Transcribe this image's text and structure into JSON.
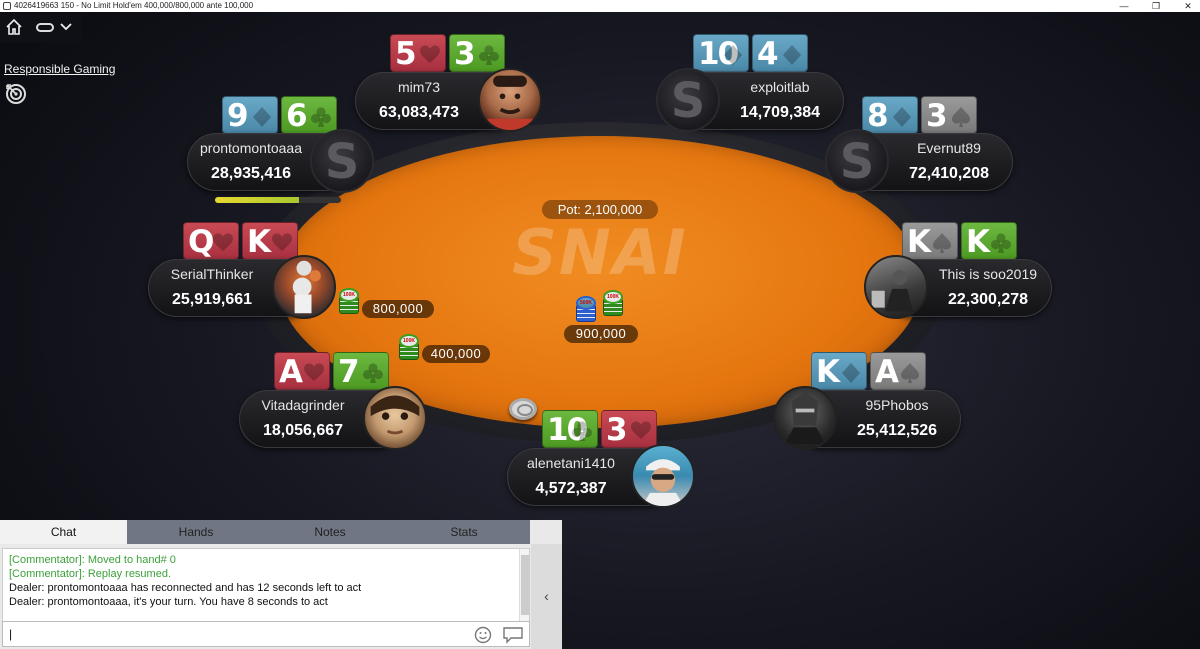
{
  "window": {
    "title": "4026419663 150 - No Limit Hold'em 400,000/800,000 ante 100,000",
    "controls": [
      "—",
      "❐",
      "✕"
    ]
  },
  "top_controls": {
    "responsible_gaming": "Responsible Gaming"
  },
  "table": {
    "logo": "SNAI",
    "pot_label": "Pot: 2,100,000",
    "center_bet": "900,000",
    "felt_color": "#e67710"
  },
  "players": [
    {
      "id": "mim73",
      "name": "mim73",
      "stack": "63,083,473",
      "cards": [
        {
          "rank": "5",
          "suit": "heart",
          "color": "red"
        },
        {
          "rank": "3",
          "suit": "club",
          "color": "green"
        }
      ],
      "avatar": "man-avatar"
    },
    {
      "id": "exploitlab",
      "name": "exploitlab",
      "stack": "14,709,384",
      "cards": [
        {
          "rank": "10",
          "suit": "diamond",
          "color": "blue"
        },
        {
          "rank": "4",
          "suit": "diamond",
          "color": "blue"
        }
      ],
      "avatar": "snai-s-avatar"
    },
    {
      "id": "prontomontoaaa",
      "name": "prontomontoaaa",
      "stack": "28,935,416",
      "cards": [
        {
          "rank": "9",
          "suit": "diamond",
          "color": "blue"
        },
        {
          "rank": "6",
          "suit": "club",
          "color": "green"
        }
      ],
      "avatar": "snai-s-avatar",
      "timer_fraction": 0.67
    },
    {
      "id": "evernut89",
      "name": "Evernut89",
      "stack": "72,410,208",
      "cards": [
        {
          "rank": "8",
          "suit": "diamond",
          "color": "blue"
        },
        {
          "rank": "3",
          "suit": "spade",
          "color": "gray"
        }
      ],
      "avatar": "snai-s-avatar"
    },
    {
      "id": "serialthinker",
      "name": "SerialThinker",
      "stack": "25,919,661",
      "cards": [
        {
          "rank": "Q",
          "suit": "heart",
          "color": "red"
        },
        {
          "rank": "K",
          "suit": "heart",
          "color": "red"
        }
      ],
      "avatar": "basketball-avatar",
      "bet": "800,000"
    },
    {
      "id": "soo2019",
      "name": "This is soo2019",
      "stack": "22,300,278",
      "cards": [
        {
          "rank": "K",
          "suit": "spade",
          "color": "gray"
        },
        {
          "rank": "K",
          "suit": "club",
          "color": "green"
        }
      ],
      "avatar": "photo-avatar"
    },
    {
      "id": "vitadagrinder",
      "name": "Vitadagrinder",
      "stack": "18,056,667",
      "cards": [
        {
          "rank": "A",
          "suit": "heart",
          "color": "red"
        },
        {
          "rank": "7",
          "suit": "club",
          "color": "green"
        }
      ],
      "avatar": "face-avatar",
      "bet": "400,000"
    },
    {
      "id": "95phobos",
      "name": "95Phobos",
      "stack": "25,412,526",
      "cards": [
        {
          "rank": "K",
          "suit": "diamond",
          "color": "blue"
        },
        {
          "rank": "A",
          "suit": "spade",
          "color": "gray"
        }
      ],
      "avatar": "warrior-avatar"
    },
    {
      "id": "alenetani1410",
      "name": "alenetani1410",
      "stack": "4,572,387",
      "cards": [
        {
          "rank": "10",
          "suit": "club",
          "color": "green"
        },
        {
          "rank": "3",
          "suit": "heart",
          "color": "red"
        }
      ],
      "avatar": "cap-man-avatar"
    }
  ],
  "chips": {
    "serialthinker": "100K",
    "vitadagrinder": "100K",
    "center_a": "500K",
    "center_b": "100K"
  },
  "chat": {
    "tabs": [
      "Chat",
      "Hands",
      "Notes",
      "Stats"
    ],
    "active_tab": "Chat",
    "lines": [
      {
        "type": "comment",
        "text": "[Commentator]: Moved to hand# 0"
      },
      {
        "type": "comment",
        "text": "[Commentator]: Replay resumed."
      },
      {
        "type": "dealer",
        "text": "Dealer: prontomontoaaa has reconnected and has 12 seconds left to act"
      },
      {
        "type": "dealer",
        "text": "Dealer: prontomontoaaa, it's your turn. You have 8 seconds to act"
      }
    ],
    "input_value": "|",
    "collapse_glyph": "‹"
  }
}
